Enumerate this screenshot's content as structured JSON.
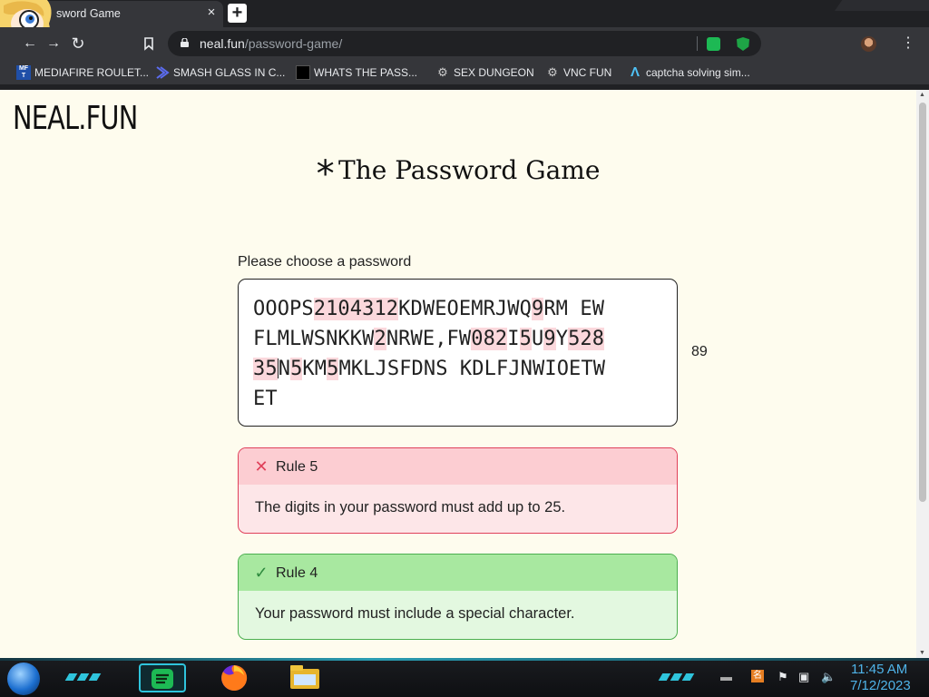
{
  "browser": {
    "tab_title": "sword Game",
    "tab_close": "×",
    "new_tab": "+",
    "address": {
      "domain": "neal.fun",
      "path": "/password-game/"
    },
    "toolbar_icons": [
      "back-icon",
      "forward-icon",
      "reload-icon",
      "bookmark-icon",
      "menu-icon"
    ],
    "bookmarks": [
      {
        "label": "MEDIAFIRE ROULET...",
        "icon": "mediafire-icon"
      },
      {
        "label": "SMASH GLASS IN C...",
        "icon": "smash-glass-icon"
      },
      {
        "label": "WHATS THE PASS...",
        "icon": "whats-the-pass-icon"
      },
      {
        "label": "SEX DUNGEON",
        "icon": "sex-dungeon-icon"
      },
      {
        "label": "VNC FUN",
        "icon": "vnc-fun-icon"
      },
      {
        "label": "captcha solving sim...",
        "icon": "captcha-icon"
      }
    ]
  },
  "page": {
    "logo": "NEAL.FUN",
    "title_star": "*",
    "title": "The Password Game",
    "prompt": "Please choose a password",
    "password": {
      "line1": [
        "OOOPS",
        "2104312",
        "KDWEOEMRJWQ",
        "9",
        "RM EW"
      ],
      "line2": [
        "FLMLWSNKKW",
        "2",
        "NRWE,FW",
        "082",
        "I",
        "5",
        "U",
        "9",
        "Y",
        "528"
      ],
      "line3": [
        "35",
        "N",
        "5",
        "KM",
        "5",
        "MKLJSFDNS KDLFJNWIOETW"
      ],
      "line4": "ET"
    },
    "char_count": "89",
    "rules": [
      {
        "status": "fail",
        "icon": "cross-icon",
        "symbol": "✕",
        "title": "Rule 5",
        "text": "The digits in your password must add up to 25."
      },
      {
        "status": "pass",
        "icon": "check-icon",
        "symbol": "✓",
        "title": "Rule 4",
        "text": "Your password must include a special character."
      }
    ]
  },
  "taskbar": {
    "clock_time": "11:45 AM",
    "clock_date": "7/12/2023"
  },
  "colors": {
    "page_bg": "#fefcee",
    "fail_border": "#e0405a",
    "pass_border": "#4caf50",
    "digit_highlight": "#fbd8dc",
    "clock": "#4fb3e8"
  }
}
